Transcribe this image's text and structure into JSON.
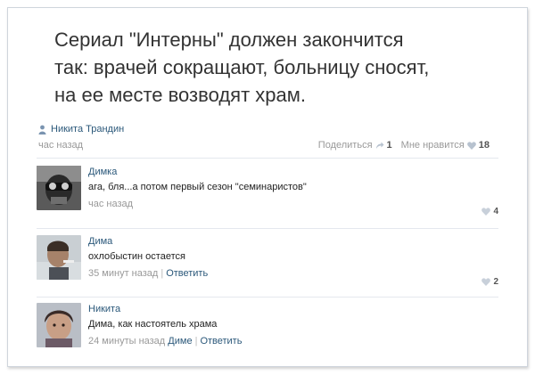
{
  "post": {
    "text_lines": [
      "Сериал \"Интерны\" должен закончится",
      "так: врачей сокращают, больницу сносят,",
      "на ее месте возводят храм."
    ],
    "author": "Никита Трандин",
    "time": "час назад",
    "share_label": "Поделиться",
    "share_count": "1",
    "like_label": "Мне нравится",
    "like_count": "18"
  },
  "comments": [
    {
      "author": "Димка",
      "text": "ага, бля...а потом первый сезон \"семинаристов\"",
      "time": "час назад",
      "likes": "4"
    },
    {
      "author": "Дима",
      "text": "охлобыстин остается",
      "time": "35 минут назад",
      "reply": "Ответить",
      "likes": "2"
    },
    {
      "author": "Никита",
      "text": "Дима, как настоятель храма",
      "time": "24 минуты назад",
      "to": "Диме",
      "reply": "Ответить"
    }
  ],
  "colors": {
    "link": "#2b587a",
    "meta": "#999999",
    "border": "#cfd5dc"
  },
  "icons": [
    "person-icon",
    "share-icon",
    "heart-icon"
  ]
}
